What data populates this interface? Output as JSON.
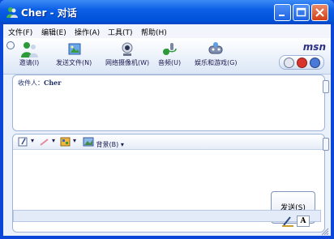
{
  "window": {
    "title": "Cher - 对话"
  },
  "menu": {
    "items": [
      "文件(F)",
      "编辑(E)",
      "操作(A)",
      "工具(T)",
      "帮助(H)"
    ]
  },
  "toolbar": {
    "items": [
      {
        "label": "邀请(I)",
        "icon": "invite-icon"
      },
      {
        "label": "发送文件(N)",
        "icon": "send-file-icon"
      },
      {
        "label": "网络摄像机(W)",
        "icon": "webcam-icon"
      },
      {
        "label": "音频(U)",
        "icon": "audio-icon"
      },
      {
        "label": "娱乐和游戏(G)",
        "icon": "games-icon"
      }
    ],
    "brand": "msn"
  },
  "to": {
    "label": "收件人：",
    "value": "Cher"
  },
  "format_bar": {
    "background_label": "背景(B)"
  },
  "compose": {
    "send_label": "发送(S)"
  },
  "bottom": {
    "font_label": "A"
  },
  "colors": {
    "titlebar": "#0b5fe6",
    "client": "#eaf1fb",
    "panel_border": "#9fb3d6"
  }
}
